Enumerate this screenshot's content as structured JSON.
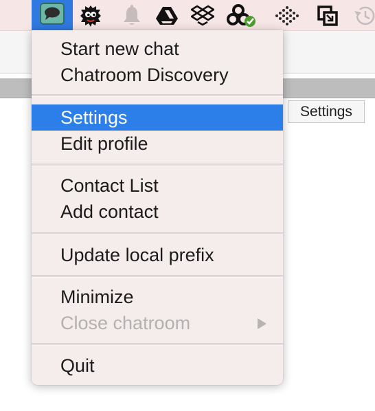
{
  "menubar": {
    "background": "#f7e6e6",
    "active_highlight": "#2f79e0",
    "icons": [
      {
        "name": "chat-bubble-icon",
        "active": true
      },
      {
        "name": "monster-icon"
      },
      {
        "name": "bell-icon"
      },
      {
        "name": "google-drive-icon"
      },
      {
        "name": "dropbox-icon"
      },
      {
        "name": "sync-icon"
      },
      {
        "name": "dots-icon"
      },
      {
        "name": "window-icon"
      },
      {
        "name": "history-icon"
      }
    ]
  },
  "menu": {
    "items": [
      {
        "label": "Start new chat"
      },
      {
        "label": "Chatroom Discovery"
      },
      {
        "label": "Settings",
        "selected": true
      },
      {
        "label": "Edit profile"
      },
      {
        "label": "Contact List"
      },
      {
        "label": "Add contact"
      },
      {
        "label": "Update local prefix"
      },
      {
        "label": "Minimize"
      },
      {
        "label": "Close chatroom",
        "disabled": true,
        "submenu_arrow": true
      },
      {
        "label": "Quit"
      }
    ],
    "selected_color": "#2c7ee8"
  },
  "tooltip": {
    "text": "Settings"
  }
}
